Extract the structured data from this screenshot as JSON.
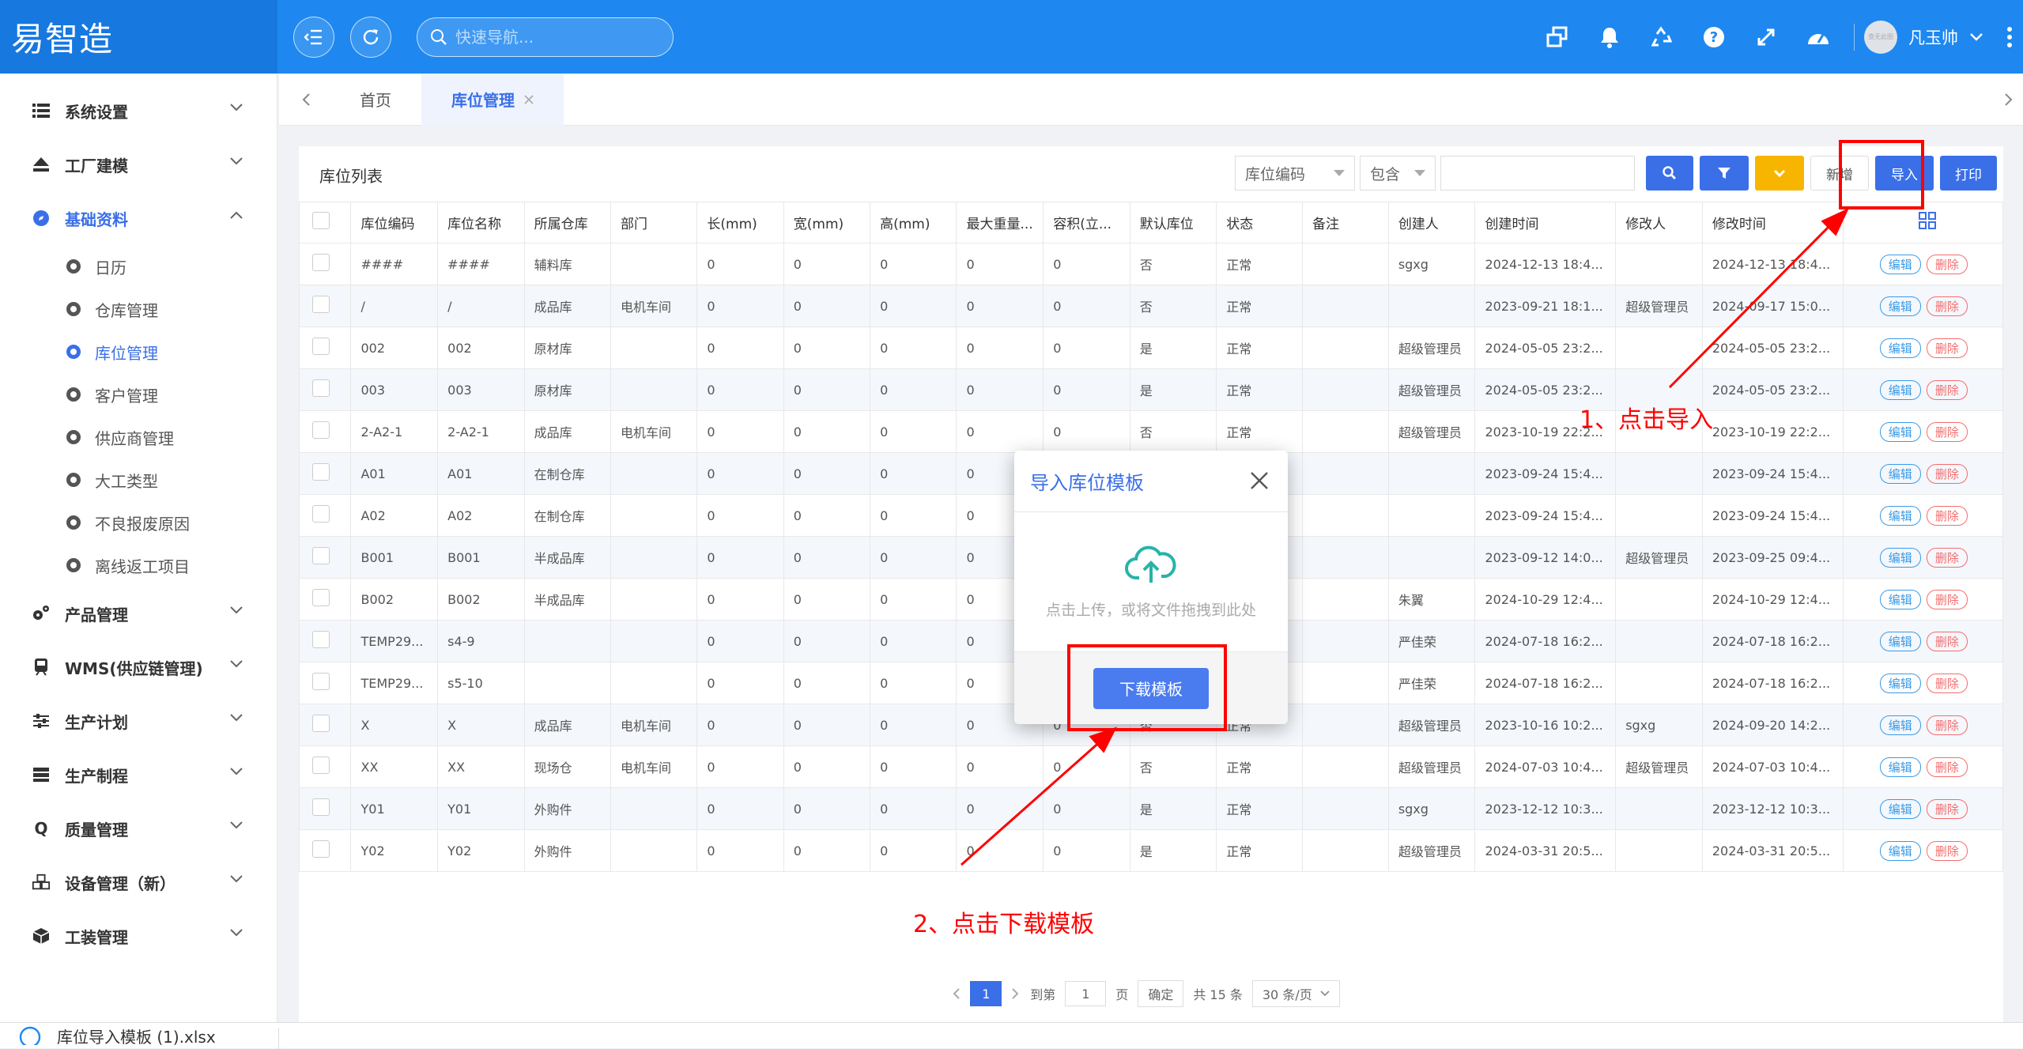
{
  "app": {
    "logo": "易智造",
    "search_placeholder": "快速导航...",
    "user": "凡玉帅",
    "avatar_text": "查无此图"
  },
  "sidebar": {
    "menus": [
      {
        "label": "系统设置",
        "icon": "list-icon"
      },
      {
        "label": "工厂建模",
        "icon": "eject-icon"
      },
      {
        "label": "基础资料",
        "icon": "compass-icon"
      }
    ],
    "sub_items": [
      "日历",
      "仓库管理",
      "库位管理",
      "客户管理",
      "供应商管理",
      "大工类型",
      "不良报废原因",
      "离线返工项目"
    ],
    "menus2": [
      {
        "label": "产品管理",
        "icon": "gears-icon"
      },
      {
        "label": "WMS(供应链管理)",
        "icon": "train-icon"
      },
      {
        "label": "生产计划",
        "icon": "sliders-icon"
      },
      {
        "label": "生产制程",
        "icon": "server-icon"
      },
      {
        "label": "质量管理",
        "icon": "q-icon"
      },
      {
        "label": "设备管理（新）",
        "icon": "cubes-icon"
      },
      {
        "label": "工装管理",
        "icon": "cube-icon"
      }
    ]
  },
  "tabs": {
    "home": "首页",
    "current": "库位管理"
  },
  "panel": {
    "title": "库位列表",
    "filter_field": "库位编码",
    "filter_op": "包含",
    "btn_add": "新增",
    "btn_import": "导入",
    "btn_print": "打印"
  },
  "table": {
    "headers": [
      "库位编码",
      "库位名称",
      "所属仓库",
      "部门",
      "长(mm)",
      "宽(mm)",
      "高(mm)",
      "最大重量...",
      "容积(立...",
      "默认库位",
      "状态",
      "备注",
      "创建人",
      "创建时间",
      "修改人",
      "修改时间"
    ],
    "rows": [
      [
        "####",
        "####",
        "辅料库",
        "",
        "0",
        "0",
        "0",
        "0",
        "0",
        "否",
        "正常",
        "",
        "sgxg",
        "2024-12-13 18:4...",
        "",
        "2024-12-13 18:4..."
      ],
      [
        "/",
        "/",
        "成品库",
        "电机车间",
        "0",
        "0",
        "0",
        "0",
        "0",
        "否",
        "正常",
        "",
        "",
        "2023-09-21 18:1...",
        "超级管理员",
        "2024-09-17 15:0..."
      ],
      [
        "002",
        "002",
        "原材库",
        "",
        "0",
        "0",
        "0",
        "0",
        "0",
        "是",
        "正常",
        "",
        "超级管理员",
        "2024-05-05 23:2...",
        "",
        "2024-05-05 23:2..."
      ],
      [
        "003",
        "003",
        "原材库",
        "",
        "0",
        "0",
        "0",
        "0",
        "0",
        "是",
        "正常",
        "",
        "超级管理员",
        "2024-05-05 23:2...",
        "",
        "2024-05-05 23:2..."
      ],
      [
        "2-A2-1",
        "2-A2-1",
        "成品库",
        "电机车间",
        "0",
        "0",
        "0",
        "0",
        "0",
        "否",
        "正常",
        "",
        "超级管理员",
        "2023-10-19 22:2...",
        "",
        "2023-10-19 22:2..."
      ],
      [
        "A01",
        "A01",
        "在制仓库",
        "",
        "0",
        "0",
        "0",
        "0",
        "",
        "",
        "",
        "",
        "",
        "2023-09-24 15:4...",
        "",
        "2023-09-24 15:4..."
      ],
      [
        "A02",
        "A02",
        "在制仓库",
        "",
        "0",
        "0",
        "0",
        "0",
        "",
        "",
        "",
        "",
        "",
        "2023-09-24 15:4...",
        "",
        "2023-09-24 15:4..."
      ],
      [
        "B001",
        "B001",
        "半成品库",
        "",
        "0",
        "0",
        "0",
        "0",
        "",
        "",
        "",
        "",
        "",
        "2023-09-12 14:0...",
        "超级管理员",
        "2023-09-25 09:4..."
      ],
      [
        "B002",
        "B002",
        "半成品库",
        "",
        "0",
        "0",
        "0",
        "0",
        "",
        "",
        "",
        "",
        "朱翼",
        "2024-10-29 12:4...",
        "",
        "2024-10-29 12:4..."
      ],
      [
        "TEMP29...",
        "s4-9",
        "",
        "",
        "0",
        "0",
        "0",
        "0",
        "",
        "",
        "",
        "",
        "严佳荣",
        "2024-07-18 16:2...",
        "",
        "2024-07-18 16:2..."
      ],
      [
        "TEMP29...",
        "s5-10",
        "",
        "",
        "0",
        "0",
        "0",
        "0",
        "",
        "",
        "",
        "",
        "严佳荣",
        "2024-07-18 16:2...",
        "",
        "2024-07-18 16:2..."
      ],
      [
        "X",
        "X",
        "成品库",
        "电机车间",
        "0",
        "0",
        "0",
        "0",
        "0",
        "否",
        "正常",
        "",
        "超级管理员",
        "2023-10-16 10:2...",
        "sgxg",
        "2024-09-20 14:2..."
      ],
      [
        "XX",
        "XX",
        "现场仓",
        "电机车间",
        "0",
        "0",
        "0",
        "0",
        "0",
        "否",
        "正常",
        "",
        "超级管理员",
        "2024-07-03 10:4...",
        "超级管理员",
        "2024-07-03 10:4..."
      ],
      [
        "Y01",
        "Y01",
        "外购件",
        "",
        "0",
        "0",
        "0",
        "0",
        "0",
        "是",
        "正常",
        "",
        "sgxg",
        "2023-12-12 10:3...",
        "",
        "2023-12-12 10:3..."
      ],
      [
        "Y02",
        "Y02",
        "外购件",
        "",
        "0",
        "0",
        "0",
        "0",
        "0",
        "是",
        "正常",
        "",
        "超级管理员",
        "2024-03-31 20:5...",
        "",
        "2024-03-31 20:5..."
      ]
    ],
    "edit_label": "编辑",
    "delete_label": "删除"
  },
  "pager": {
    "current": "1",
    "goto": "到第",
    "goto_value": "1",
    "page_unit": "页",
    "confirm": "确定",
    "total": "共 15 条",
    "page_size": "30 条/页"
  },
  "modal": {
    "title": "导入库位模板",
    "hint": "点击上传，或将文件拖拽到此处",
    "download": "下载模板"
  },
  "annotations": {
    "step1": "1、点击导入",
    "step2": "2、点击下载模板"
  },
  "colors": {
    "primary": "#1e88f0",
    "accent": "#3a6fe8",
    "annotation": "#ff0000"
  },
  "download_bar": {
    "filename": "库位导入模板 (1).xlsx"
  }
}
